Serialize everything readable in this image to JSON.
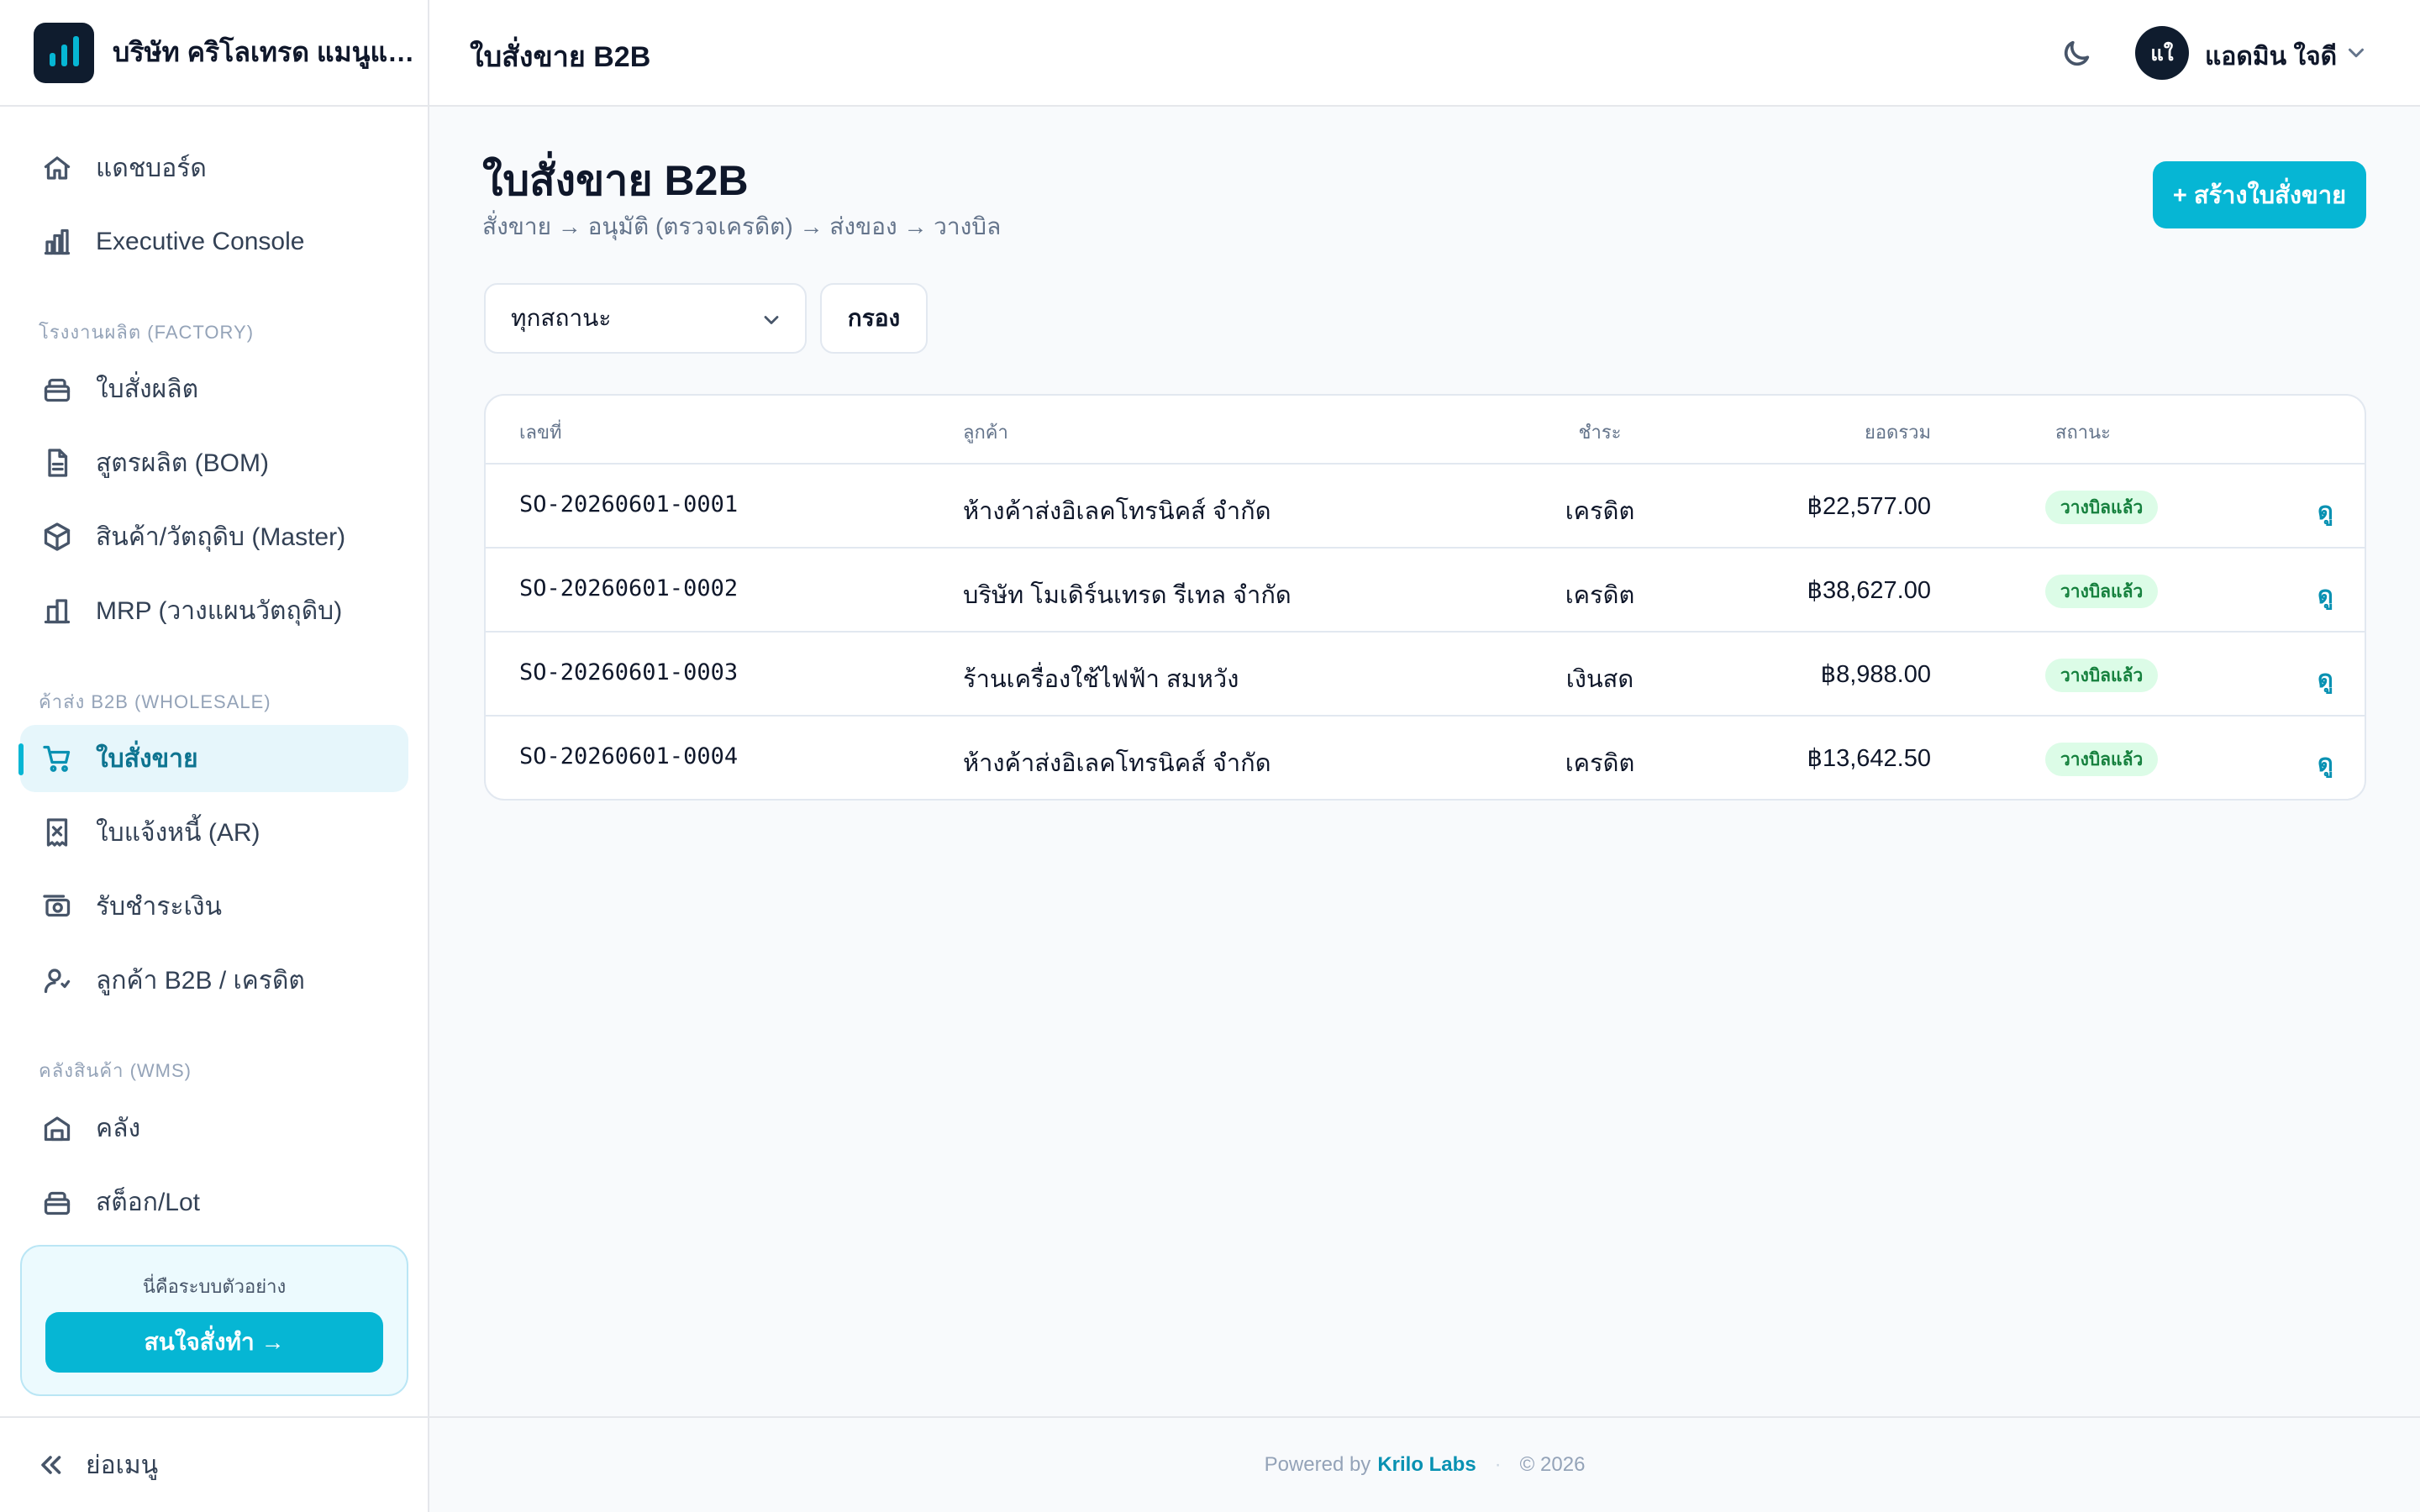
{
  "brand": {
    "name": "บริษัท คริโลเทรด แมนูแฟ..."
  },
  "topbar": {
    "title": "ใบสั่งขาย B2B",
    "user_initials": "แใ",
    "user_name": "แอดมิน ใจดี"
  },
  "sidebar": {
    "items_top": [
      {
        "label": "แดชบอร์ด",
        "icon": "home-icon"
      },
      {
        "label": "Executive Console",
        "icon": "bar-chart-icon"
      }
    ],
    "section_factory": "โรงงานผลิต (FACTORY)",
    "items_factory": [
      {
        "label": "ใบสั่งผลิต",
        "icon": "box-icon"
      },
      {
        "label": "สูตรผลิต (BOM)",
        "icon": "document-icon"
      },
      {
        "label": "สินค้า/วัตถุดิบ (Master)",
        "icon": "cube-icon"
      },
      {
        "label": "MRP (วางแผนวัตถุดิบ)",
        "icon": "building-icon"
      }
    ],
    "section_b2b": "ค้าส่ง B2B (WHOLESALE)",
    "items_b2b": [
      {
        "label": "ใบสั่งขาย",
        "icon": "cart-icon",
        "active": true
      },
      {
        "label": "ใบแจ้งหนี้ (AR)",
        "icon": "receipt-icon"
      },
      {
        "label": "รับชำระเงิน",
        "icon": "cash-icon"
      },
      {
        "label": "ลูกค้า B2B / เครดิต",
        "icon": "users-icon"
      }
    ],
    "section_wms": "คลังสินค้า (WMS)",
    "items_wms": [
      {
        "label": "คลัง",
        "icon": "warehouse-icon"
      },
      {
        "label": "สต็อก/Lot",
        "icon": "box-icon"
      }
    ],
    "demo_text": "นี่คือระบบตัวอย่าง",
    "demo_button": "สนใจสั่งทำ →",
    "collapse_label": "ย่อเมนู"
  },
  "main": {
    "title": "ใบสั่งขาย B2B",
    "workflow": "สั่งขาย → อนุมัติ (ตรวจเครดิต) → ส่งของ → วางบิล",
    "create_button": "+ สร้างใบสั่งขาย",
    "status_filter": {
      "value": "ทุกสถานะ"
    },
    "filter_button": "กรอง",
    "table": {
      "columns": [
        "เลขที่",
        "ลูกค้า",
        "ชำระ",
        "ยอดรวม",
        "สถานะ"
      ],
      "rows": [
        {
          "number": "SO-20260601-0001",
          "customer": "ห้างค้าส่งอิเลคโทรนิคส์ จำกัด",
          "payment": "เครดิต",
          "total": "฿22,577.00",
          "status": "วางบิลแล้ว",
          "action": "ดู"
        },
        {
          "number": "SO-20260601-0002",
          "customer": "บริษัท โมเดิร์นเทรด รีเทล จำกัด",
          "payment": "เครดิต",
          "total": "฿38,627.00",
          "status": "วางบิลแล้ว",
          "action": "ดู"
        },
        {
          "number": "SO-20260601-0003",
          "customer": "ร้านเครื่องใช้ไฟฟ้า สมหวัง",
          "payment": "เงินสด",
          "total": "฿8,988.00",
          "status": "วางบิลแล้ว",
          "action": "ดู"
        },
        {
          "number": "SO-20260601-0004",
          "customer": "ห้างค้าส่งอิเลคโทรนิคส์ จำกัด",
          "payment": "เครดิต",
          "total": "฿13,642.50",
          "status": "วางบิลแล้ว",
          "action": "ดู"
        }
      ]
    }
  },
  "footer": {
    "powered_by": "Powered by",
    "brand": "Krilo Labs",
    "copyright": "© 2026"
  },
  "colors": {
    "accent": "#06b6d4",
    "accent_dark": "#0891b2",
    "active_bg": "#e6f6fb",
    "badge_bg": "#dcfce7",
    "badge_text": "#15803d"
  }
}
